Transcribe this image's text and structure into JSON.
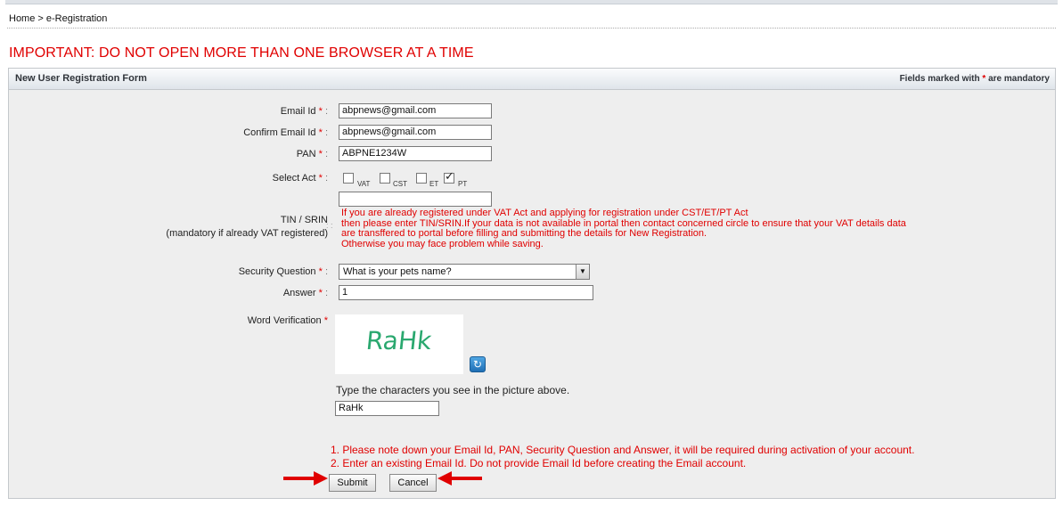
{
  "breadcrumb": {
    "home": "Home",
    "separator": ">",
    "current": "e-Registration"
  },
  "warning": "IMPORTANT: DO NOT OPEN MORE THAN ONE BROWSER AT A TIME",
  "form": {
    "title": "New User Registration Form",
    "mandatory_note_prefix": "Fields marked with",
    "mandatory_note_star": "*",
    "mandatory_note_suffix": "are mandatory",
    "email": {
      "label": "Email Id",
      "value": "abpnews@gmail.com"
    },
    "confirm_email": {
      "label": "Confirm Email Id",
      "value": "abpnews@gmail.com"
    },
    "pan": {
      "label": "PAN",
      "value": "ABPNE1234W"
    },
    "select_act": {
      "label": "Select Act",
      "options": [
        {
          "label": "VAT",
          "checked": false
        },
        {
          "label": "CST",
          "checked": false
        },
        {
          "label": "ET",
          "checked": false
        },
        {
          "label": "PT",
          "checked": true
        }
      ]
    },
    "tin": {
      "label": "TIN / SRIN",
      "sublabel": "(mandatory if already VAT registered)",
      "value": "",
      "help_lines": [
        "If you are already registered under VAT Act and applying for registration under CST/ET/PT Act",
        "then please enter TIN/SRIN.If your data is not available in portal then contact concerned circle to ensure that your VAT details data",
        "are transffered to portal before filling and submitting the details for New Registration.",
        "Otherwise you may face problem while saving."
      ]
    },
    "security_question": {
      "label": "Security Question",
      "value": "What is your pets name?"
    },
    "answer": {
      "label": "Answer",
      "value": "1"
    },
    "word_verification": {
      "label": "Word Verification",
      "captcha_text": "RaHk",
      "hint": "Type the characters you see in the picture above.",
      "value": "RaHk"
    },
    "notes": [
      "1. Please note down your Email Id, PAN, Security Question and Answer, it will be required during activation of your account.",
      "2. Enter an existing Email Id. Do not provide Email Id before creating the Email account."
    ],
    "submit_label": "Submit",
    "cancel_label": "Cancel"
  },
  "colors": {
    "warning_red": "#e00000",
    "panel_bg": "#eeeeee",
    "arrow_red": "#e00000"
  },
  "icons": {
    "refresh": "refresh-icon",
    "dropdown": "chevron-down-icon",
    "checkmark": "checkmark-icon"
  }
}
